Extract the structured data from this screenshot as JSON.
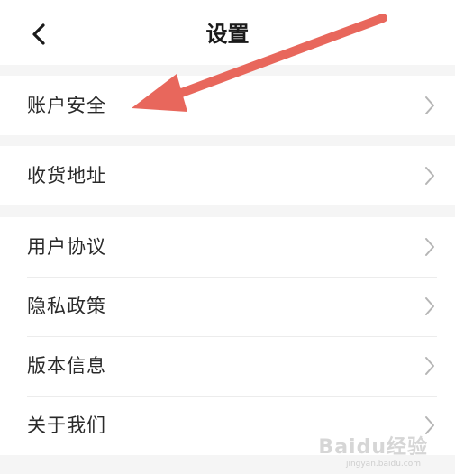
{
  "header": {
    "title": "设置",
    "back_icon": "chevron-left-icon"
  },
  "groups": [
    {
      "items": [
        {
          "label": "账户安全",
          "icon": "chevron-right-icon"
        }
      ]
    },
    {
      "items": [
        {
          "label": "收货地址",
          "icon": "chevron-right-icon"
        }
      ]
    },
    {
      "items": [
        {
          "label": "用户协议",
          "icon": "chevron-right-icon"
        },
        {
          "label": "隐私政策",
          "icon": "chevron-right-icon"
        },
        {
          "label": "版本信息",
          "icon": "chevron-right-icon"
        },
        {
          "label": "关于我们",
          "icon": "chevron-right-icon"
        }
      ]
    }
  ],
  "annotation": {
    "arrow_color": "#e8675c",
    "points_to": "账户安全"
  },
  "watermark": {
    "text": "Baidu经验",
    "subtext": "jingyan.baidu.com"
  },
  "colors": {
    "background": "#f5f5f5",
    "surface": "#ffffff",
    "divider": "#ececec",
    "chevron": "#b5b5b5"
  }
}
